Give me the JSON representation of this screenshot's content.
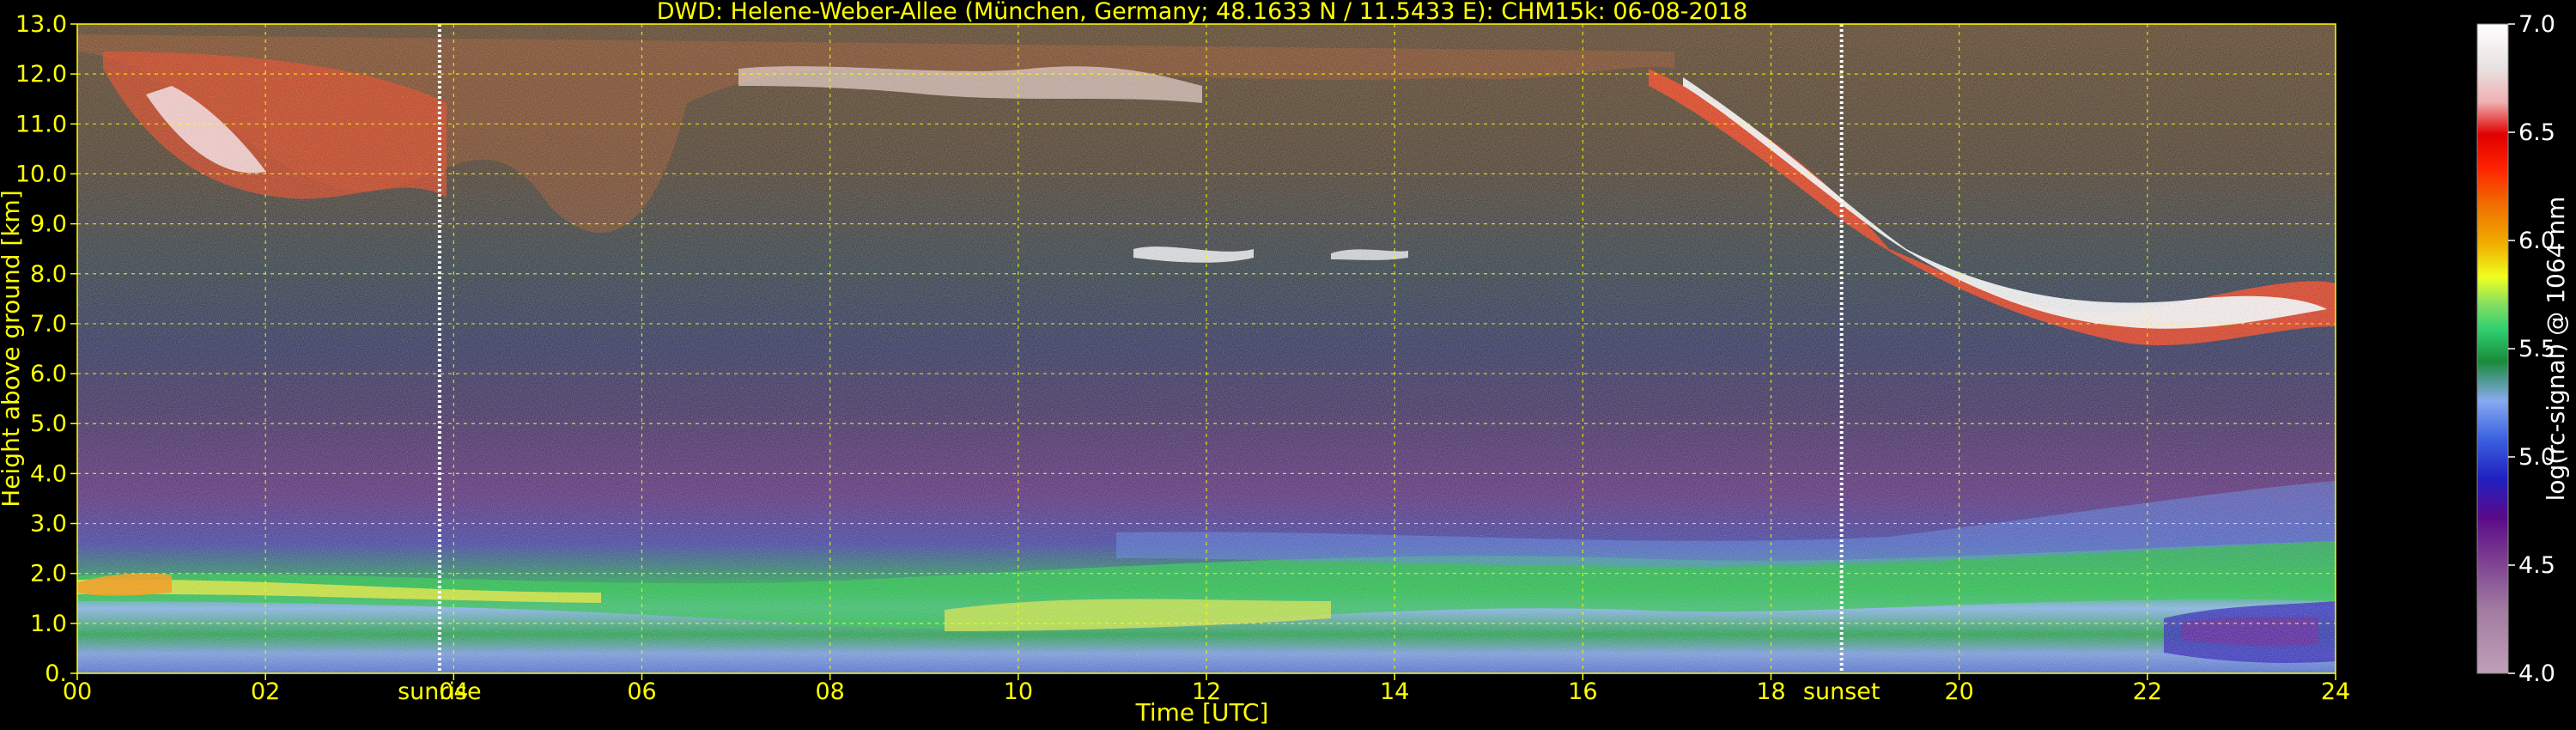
{
  "chart_data": {
    "type": "heatmap",
    "title": "DWD: Helene-Weber-Allee (München, Germany; 48.1633 N / 11.5433 E):    CHM15k: 06-08-2018",
    "xlabel": "Time [UTC]",
    "ylabel": "Height above ground [km]",
    "xlim": [
      0,
      24
    ],
    "ylim": [
      0,
      13
    ],
    "x_ticks": [
      "00",
      "02",
      "04",
      "06",
      "08",
      "10",
      "12",
      "14",
      "16",
      "18",
      "20",
      "22",
      "24"
    ],
    "y_ticks": [
      "0.",
      "1.0",
      "2.0",
      "3.0",
      "4.0",
      "5.0",
      "6.0",
      "7.0",
      "8.0",
      "9.0",
      "10.0",
      "11.0",
      "12.0",
      "13.0"
    ],
    "grid": true,
    "markers": [
      {
        "label": "sunrise",
        "x": 3.85
      },
      {
        "label": "sunset",
        "x": 18.75
      }
    ],
    "colorbar": {
      "label": "log(rc-signal) @ 1064 nm",
      "range": [
        4.0,
        7.0
      ],
      "ticks": [
        "4.0",
        "4.5",
        "5.0",
        "5.5",
        "6.0",
        "6.5",
        "7.0"
      ]
    },
    "colors": {
      "text": "#ffff00",
      "grid": "#ffff00",
      "background": "#000000"
    }
  }
}
